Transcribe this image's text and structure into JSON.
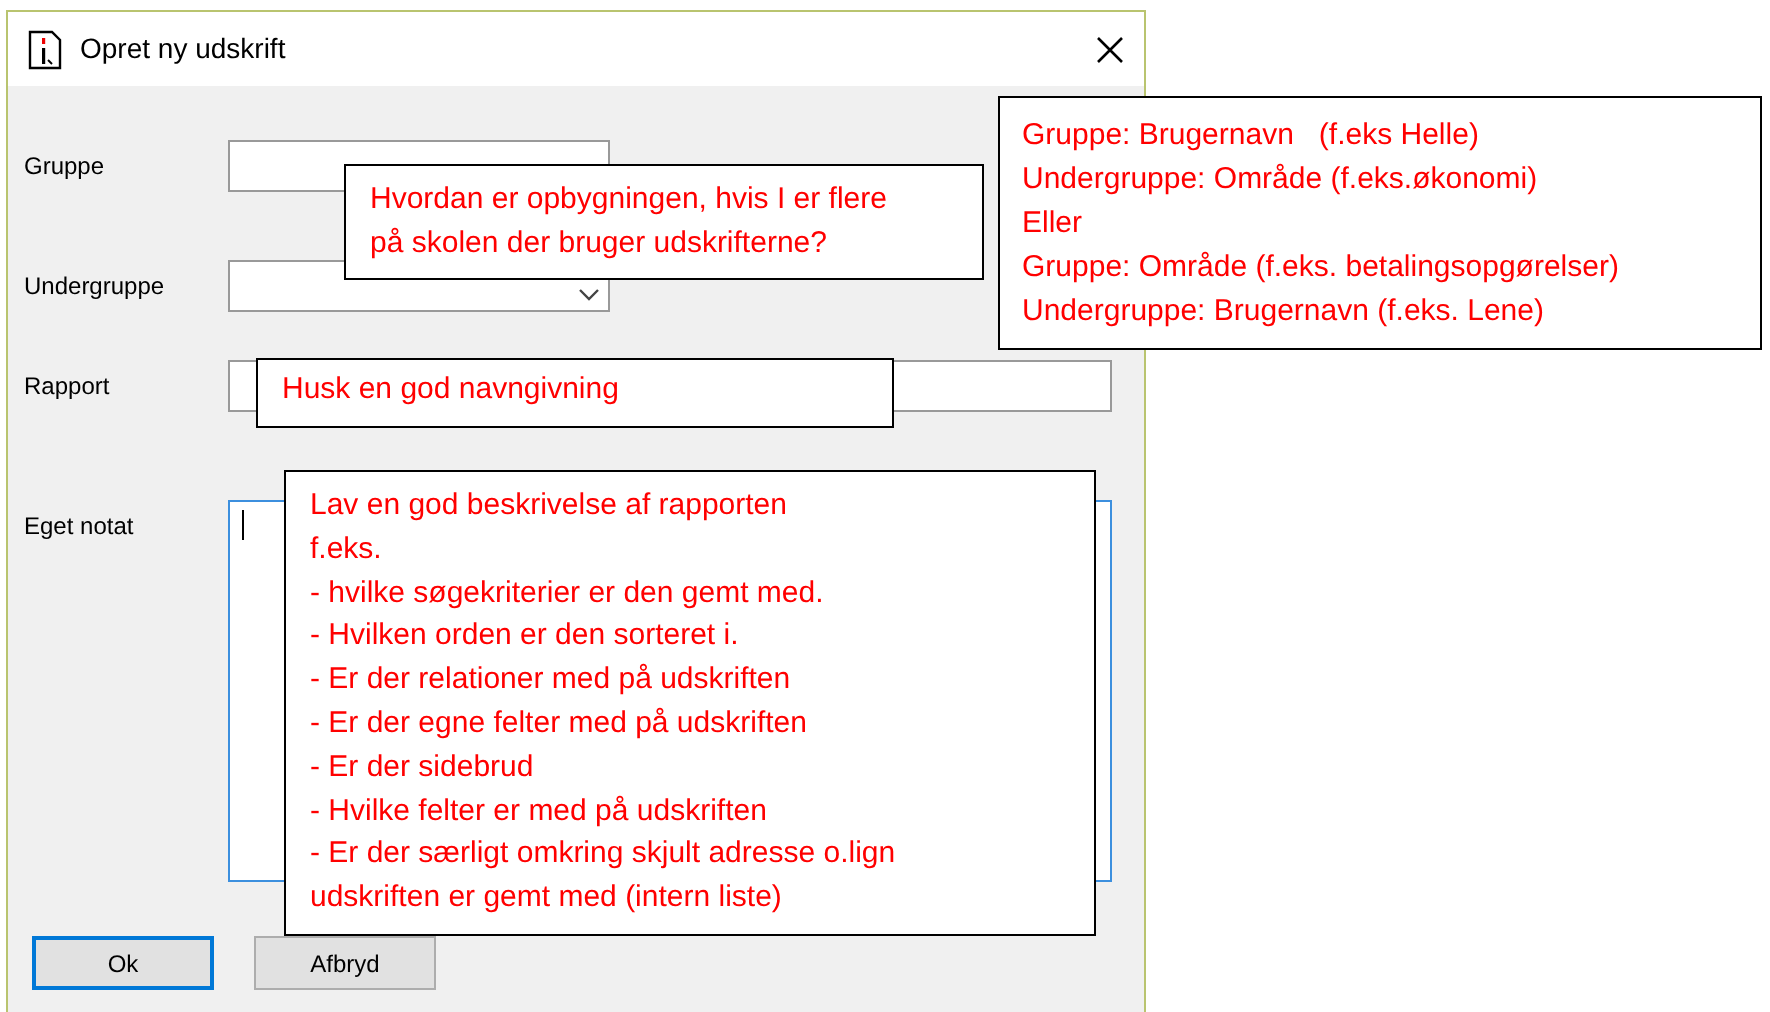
{
  "window": {
    "title": "Opret ny udskrift"
  },
  "fields": [
    {
      "label": "Gruppe",
      "kind": "text",
      "focused": false
    },
    {
      "label": "Undergruppe",
      "kind": "combo",
      "focused": false
    },
    {
      "label": "Rapport",
      "kind": "wide",
      "focused": false
    },
    {
      "label": "Eget notat",
      "kind": "textarea",
      "focused": true
    }
  ],
  "buttons": [
    {
      "label": "Ok",
      "default": true
    },
    {
      "label": "Afbryd",
      "default": false
    }
  ],
  "callouts": [
    {
      "lines": [
        "Hvordan er opbygningen, hvis I er flere",
        "på skolen der bruger udskrifterne?"
      ]
    },
    {
      "lines": [
        "Gruppe: Brugernavn   (f.eks Helle)",
        "Undergruppe: Område (f.eks.økonomi)",
        "Eller",
        "Gruppe: Område (f.eks. betalingsopgørelser)",
        "Undergruppe: Brugernavn (f.eks. Lene)"
      ]
    },
    {
      "lines": [
        "Husk en god navngivning"
      ]
    },
    {
      "lines": [
        "Lav en god beskrivelse af rapporten",
        "f.eks.",
        "- hvilke søgekriterier er den gemt med.",
        "- Hvilken orden er den sorteret i.",
        "- Er der relationer med på udskriften",
        "- Er der egne felter med på udskriften",
        "- Er der sidebrud",
        "- Hvilke felter er med på udskriften",
        "- Er der særligt omkring skjult adresse o.lign",
        "udskriften er gemt med (intern liste)"
      ]
    }
  ]
}
